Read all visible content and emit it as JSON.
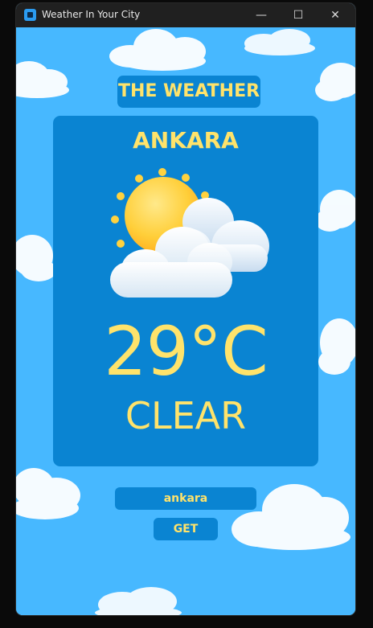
{
  "window": {
    "title": "Weather In Your City",
    "controls": {
      "minimize": "—",
      "maximize": "☐",
      "close": "✕"
    }
  },
  "header": {
    "label": "THE WEATHER"
  },
  "weather": {
    "city": "ANKARA",
    "temperature": "29°C",
    "condition": "CLEAR",
    "icon": "sun-behind-clouds-icon"
  },
  "search": {
    "value": "ankara",
    "button_label": "GET"
  },
  "colors": {
    "accent": "#ffe36b",
    "panel": "#0a84d2",
    "sky": "#47b8ff"
  }
}
